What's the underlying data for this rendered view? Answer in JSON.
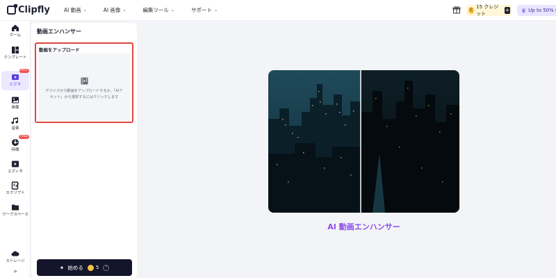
{
  "header": {
    "logo": "Clipfly",
    "nav": [
      {
        "label": "AI 動画"
      },
      {
        "label": "AI 画像"
      },
      {
        "label": "編集ツール"
      },
      {
        "label": "サポート"
      }
    ],
    "credits": "15 クレジット",
    "upgrade": "Up to 50% O"
  },
  "sidebar": {
    "items": [
      {
        "label": "ホーム",
        "icon": "home-icon"
      },
      {
        "label": "テンプレート",
        "icon": "template-icon"
      },
      {
        "label": "ビデオ",
        "icon": "video-icon",
        "badge": "HOT"
      },
      {
        "label": "画像",
        "icon": "image-icon"
      },
      {
        "label": "音楽",
        "icon": "music-icon"
      },
      {
        "label": "特徴",
        "icon": "features-icon",
        "badge": "FREE"
      },
      {
        "label": "エディタ",
        "icon": "editor-icon"
      },
      {
        "label": "スクリプト",
        "icon": "script-icon"
      },
      {
        "label": "ワークスペース",
        "icon": "folder-icon"
      },
      {
        "label": "ストレージ",
        "icon": "cloud-icon"
      }
    ],
    "expand": "»"
  },
  "panel": {
    "title": "動画エンハンサー",
    "upload_label": "動画をアップロード",
    "upload_hint": "デバイスから動画をアップロードするか、「AIアセット」から選択するにはクリックします",
    "start_button": "始める",
    "cost": "5",
    "help": "?"
  },
  "main": {
    "caption": "AI 動画エンハンサー"
  },
  "colors": {
    "accent": "#8a4fe8",
    "highlight_border": "#e0463e",
    "button_bg": "#14142a"
  }
}
